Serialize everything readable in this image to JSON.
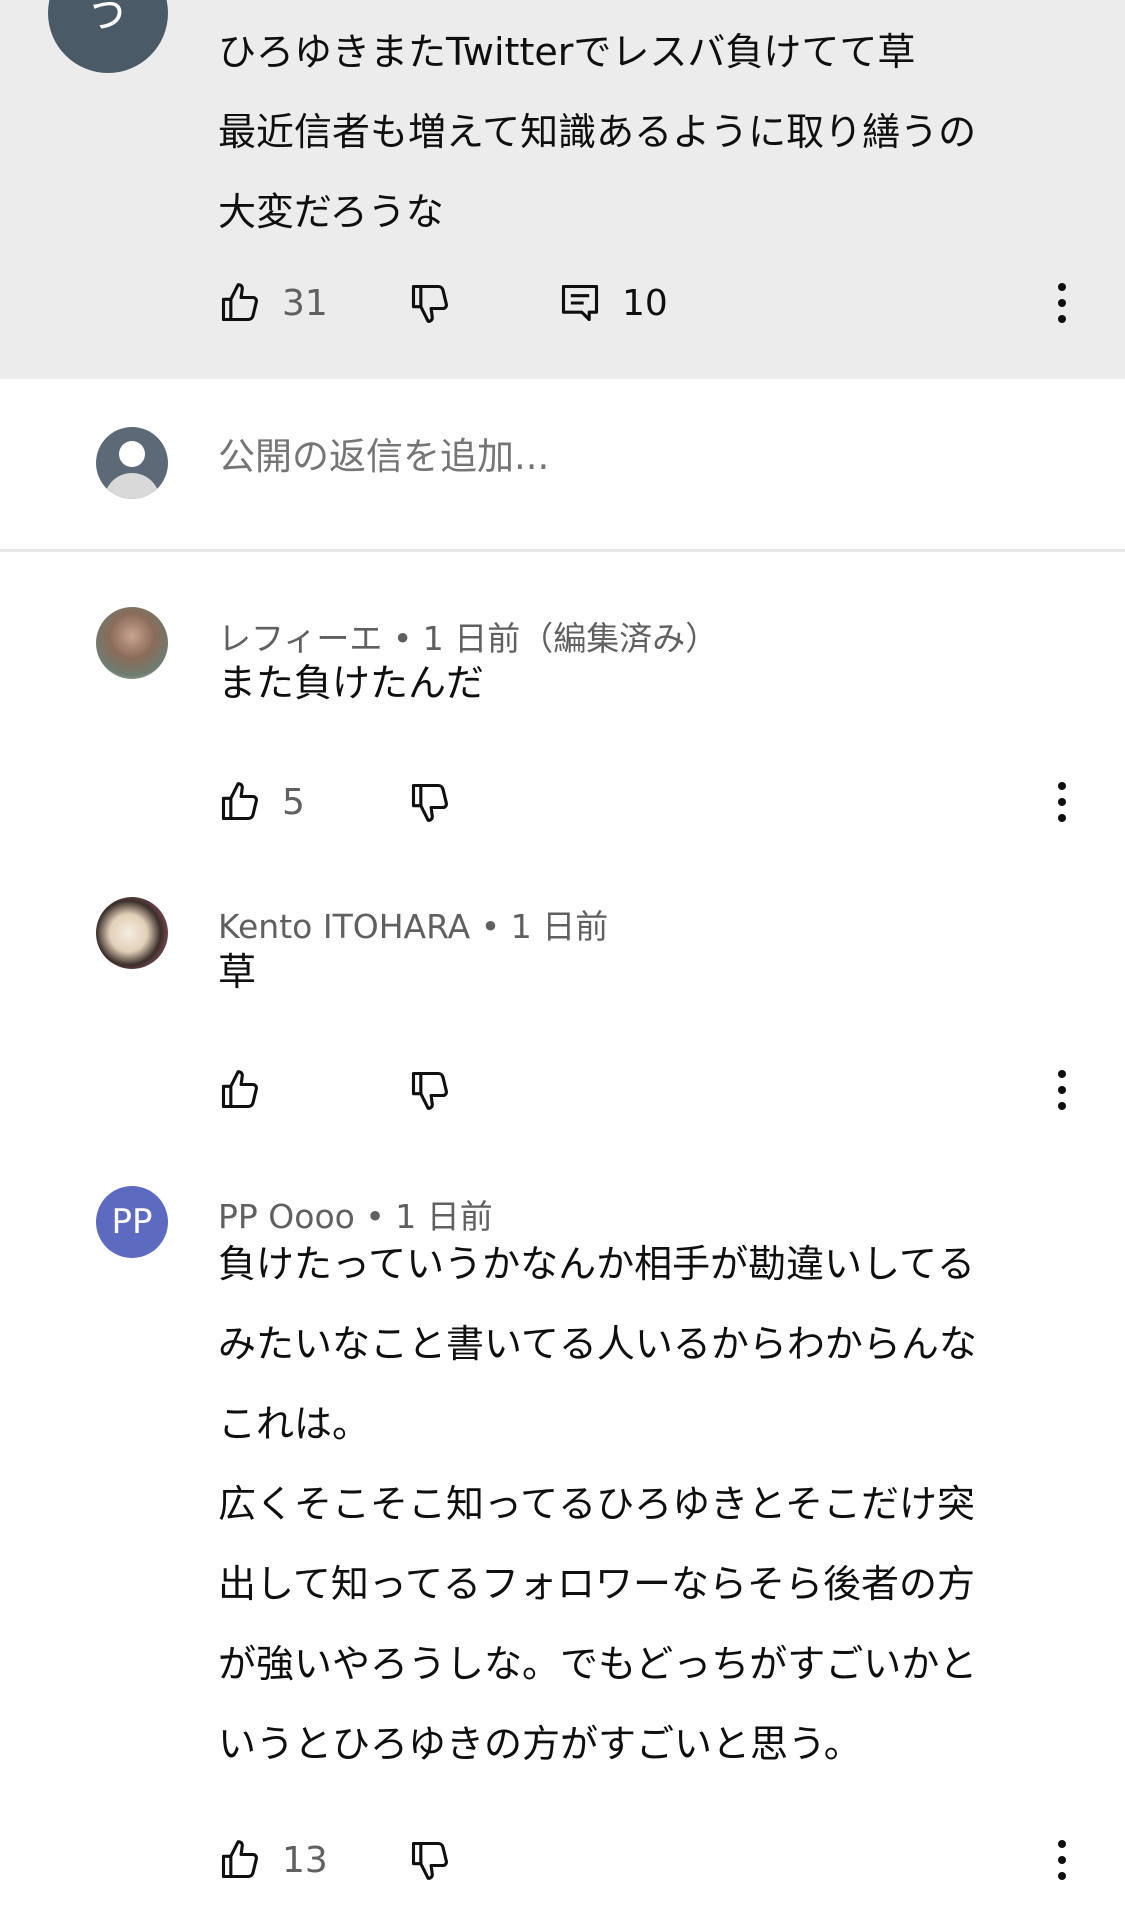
{
  "parent_comment": {
    "avatar_letter": "う",
    "text_lines": [
      "ひろゆきまたTwitterでレスバ負けてて草",
      "最近信者も増えて知識あるように取り繕うの",
      "大変だろうな"
    ],
    "likes": "31",
    "replies": "10"
  },
  "reply_box": {
    "placeholder": "公開の返信を追加..."
  },
  "replies": [
    {
      "author": "レフィーエ",
      "time": "1 日前（編集済み）",
      "text_lines": [
        "また負けたんだ"
      ],
      "likes": "5"
    },
    {
      "author": "Kento ITOHARA",
      "time": "1 日前",
      "text_lines": [
        "草"
      ],
      "likes": ""
    },
    {
      "author": "PP Oooo",
      "avatar_text": "PP",
      "time": "1 日前",
      "text_lines": [
        "負けたっていうかなんか相手が勘違いしてる",
        "みたいなこと書いてる人いるからわからんな",
        "これは。",
        "広くそこそこ知ってるひろゆきとそこだけ突",
        "出して知ってるフォロワーならそら後者の方",
        "が強いやろうしな。でもどっちがすごいかと",
        "いうとひろゆきの方がすごいと思う。"
      ],
      "likes": "13"
    }
  ],
  "colors": {
    "parent_bg": "#ececec",
    "pp_avatar": "#5c6bc0",
    "meta": "#606060"
  },
  "icons": [
    "thumb-up-icon",
    "thumb-down-icon",
    "reply-icon",
    "more-vert-icon",
    "user-avatar-icon"
  ]
}
